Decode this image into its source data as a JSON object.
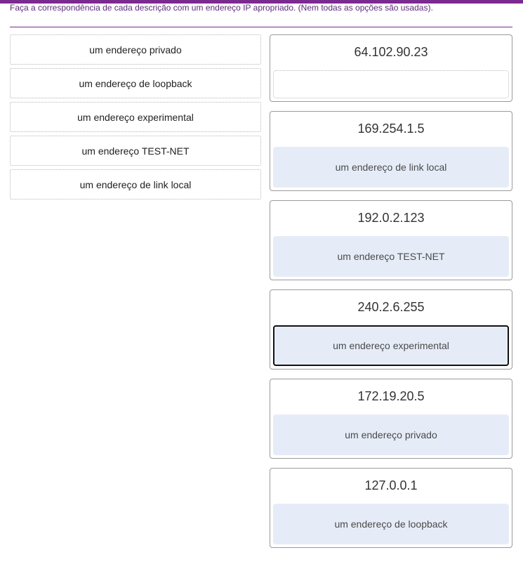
{
  "instruction": "Faça a correspondência de cada descrição com um endereço IP apropriado. (Nem todas as opções são usadas).",
  "accent_color": "#7b2a8f",
  "options": [
    {
      "label": "um endereço privado"
    },
    {
      "label": "um endereço de loopback"
    },
    {
      "label": "um endereço experimental"
    },
    {
      "label": "um endereço TEST-NET"
    },
    {
      "label": "um endereço de link local"
    }
  ],
  "targets": [
    {
      "ip": "64.102.90.23",
      "answer": ""
    },
    {
      "ip": "169.254.1.5",
      "answer": "um endereço de link local"
    },
    {
      "ip": "192.0.2.123",
      "answer": "um endereço TEST-NET"
    },
    {
      "ip": "240.2.6.255",
      "answer": "um endereço experimental"
    },
    {
      "ip": "172.19.20.5",
      "answer": "um endereço privado"
    },
    {
      "ip": "127.0.0.1",
      "answer": "um endereço de loopback"
    }
  ]
}
